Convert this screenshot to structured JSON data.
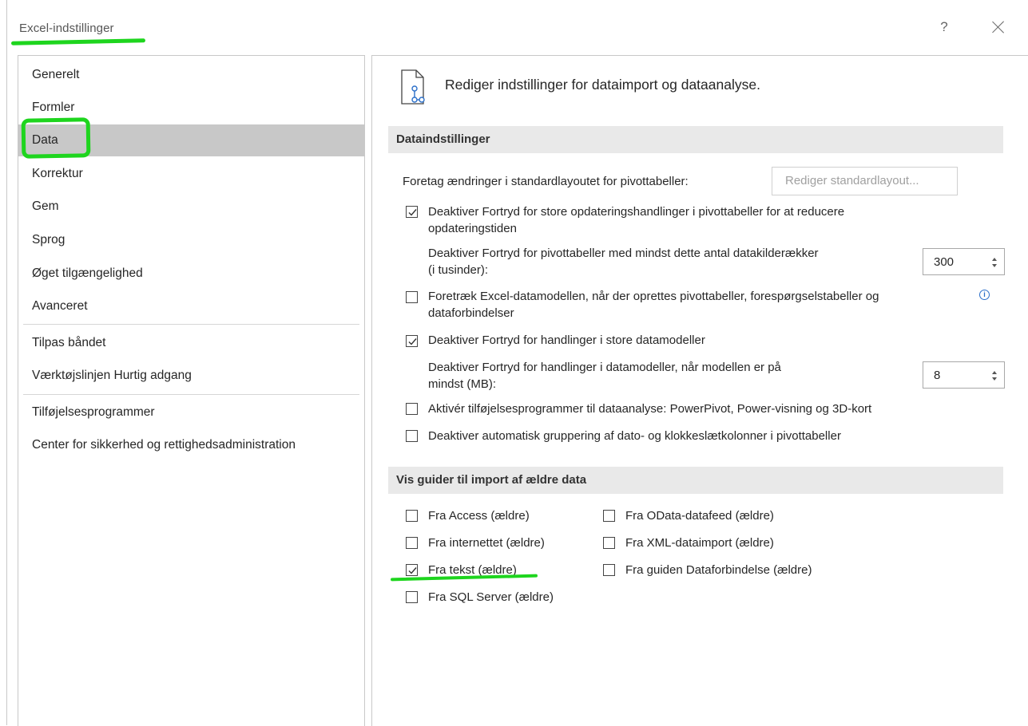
{
  "window": {
    "title": "Excel-indstillinger",
    "help_label": "?"
  },
  "sidebar": {
    "items": [
      {
        "label": "Generelt"
      },
      {
        "label": "Formler"
      },
      {
        "label": "Data"
      },
      {
        "label": "Korrektur"
      },
      {
        "label": "Gem"
      },
      {
        "label": "Sprog"
      },
      {
        "label": "Øget tilgængelighed"
      },
      {
        "label": "Avanceret"
      },
      {
        "label": "Tilpas båndet"
      },
      {
        "label": "Værktøjslinjen Hurtig adgang"
      },
      {
        "label": "Tilføjelsesprogrammer"
      },
      {
        "label": "Center for sikkerhed og rettighedsadministration"
      }
    ],
    "selected": "Data"
  },
  "header": {
    "icon": "document-data-icon",
    "text": "Rediger indstillinger for dataimport og dataanalyse."
  },
  "sections": {
    "data_settings": "Dataindstillinger",
    "legacy_wizards": "Vis guider til import af ældre data"
  },
  "data_settings": {
    "pivot_layout_label": "Foretag ændringer i standardlayoutet for pivottabeller:",
    "pivot_layout_button": "Rediger standardlayout...",
    "disable_undo_pivot": {
      "line1": "Deaktiver Fortryd for store opdateringshandlinger i pivottabeller for at reducere",
      "line2": "opdateringstiden",
      "checked": true
    },
    "pivot_rows_label": {
      "line1": "Deaktiver Fortryd for pivottabeller med mindst dette antal datakilderækker",
      "line2": "(i tusinder):"
    },
    "pivot_rows_value": "300",
    "prefer_datamodel": {
      "line1": "Foretræk Excel-datamodellen, når der oprettes pivottabeller, forespørgselstabeller og",
      "line2": "dataforbindelser",
      "checked": false
    },
    "info_icon": "info-icon",
    "disable_undo_datamodel": {
      "label": "Deaktiver Fortryd for handlinger i store datamodeller",
      "checked": true
    },
    "datamodel_size_label": {
      "line1": "Deaktiver Fortryd for handlinger i datamodeller, når modellen er på",
      "line2": "mindst (MB):"
    },
    "datamodel_size_value": "8",
    "enable_addins": {
      "label": "Aktivér tilføjelsesprogrammer til dataanalyse: PowerPivot, Power-visning og 3D-kort",
      "checked": false
    },
    "disable_grouping": {
      "label": "Deaktiver automatisk gruppering af dato- og klokkeslætkolonner i pivottabeller",
      "checked": false
    }
  },
  "legacy": {
    "access": {
      "label": "Fra Access (ældre)",
      "checked": false
    },
    "internet": {
      "label": "Fra internettet (ældre)",
      "checked": false
    },
    "text": {
      "label": "Fra tekst (ældre)",
      "checked": true
    },
    "sql": {
      "label": "Fra SQL Server (ældre)",
      "checked": false
    },
    "odata": {
      "label": "Fra OData-datafeed (ældre)",
      "checked": false
    },
    "xml": {
      "label": "Fra XML-dataimport (ældre)",
      "checked": false
    },
    "dataconn": {
      "label": "Fra guiden Dataforbindelse (ældre)",
      "checked": false
    }
  },
  "colors": {
    "highlight": "#1ed51e",
    "selected_bg": "#c8c8c8",
    "section_bg": "#e9e9e9",
    "info": "#2b6fc9"
  }
}
